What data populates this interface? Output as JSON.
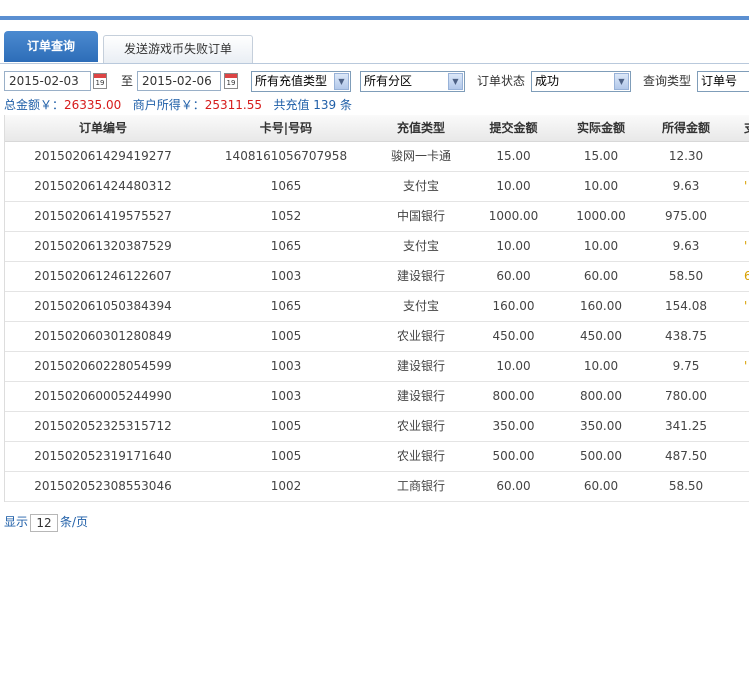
{
  "tabs": [
    {
      "label": "订单查询"
    },
    {
      "label": "发送游戏币失败订单"
    }
  ],
  "filters": {
    "start_date": "2015-02-03",
    "range_separator": "至",
    "end_date": "2015-02-06",
    "calendar_icon_text": "19",
    "recharge_type": "所有充值类型",
    "region": "所有分区",
    "order_status_label": "订单状态",
    "order_status": "成功",
    "query_type_label": "查询类型",
    "query_type": "订单号"
  },
  "summary": {
    "total_label": "总金额￥：",
    "total_value": "26335.00",
    "merchant_label": "商户所得￥：",
    "merchant_value": "25311.55",
    "count_text": "共充值 139 条"
  },
  "table": {
    "columns": [
      "订单编号",
      "卡号|号码",
      "充值类型",
      "提交金额",
      "实际金额",
      "所得金额",
      "支"
    ],
    "rows": [
      {
        "order_no": "201502061429419277",
        "card": "1408161056707958",
        "type": "骏网一卡通",
        "submit": "15.00",
        "actual": "15.00",
        "earned": "12.30",
        "extra": ""
      },
      {
        "order_no": "201502061424480312",
        "card": "1065",
        "type": "支付宝",
        "submit": "10.00",
        "actual": "10.00",
        "earned": "9.63",
        "extra": "'"
      },
      {
        "order_no": "201502061419575527",
        "card": "1052",
        "type": "中国银行",
        "submit": "1000.00",
        "actual": "1000.00",
        "earned": "975.00",
        "extra": ""
      },
      {
        "order_no": "201502061320387529",
        "card": "1065",
        "type": "支付宝",
        "submit": "10.00",
        "actual": "10.00",
        "earned": "9.63",
        "extra": "'"
      },
      {
        "order_no": "201502061246122607",
        "card": "1003",
        "type": "建设银行",
        "submit": "60.00",
        "actual": "60.00",
        "earned": "58.50",
        "extra": "6"
      },
      {
        "order_no": "201502061050384394",
        "card": "1065",
        "type": "支付宝",
        "submit": "160.00",
        "actual": "160.00",
        "earned": "154.08",
        "extra": "'"
      },
      {
        "order_no": "201502060301280849",
        "card": "1005",
        "type": "农业银行",
        "submit": "450.00",
        "actual": "450.00",
        "earned": "438.75",
        "extra": ""
      },
      {
        "order_no": "201502060228054599",
        "card": "1003",
        "type": "建设银行",
        "submit": "10.00",
        "actual": "10.00",
        "earned": "9.75",
        "extra": "'"
      },
      {
        "order_no": "201502060005244990",
        "card": "1003",
        "type": "建设银行",
        "submit": "800.00",
        "actual": "800.00",
        "earned": "780.00",
        "extra": ""
      },
      {
        "order_no": "201502052325315712",
        "card": "1005",
        "type": "农业银行",
        "submit": "350.00",
        "actual": "350.00",
        "earned": "341.25",
        "extra": ""
      },
      {
        "order_no": "201502052319171640",
        "card": "1005",
        "type": "农业银行",
        "submit": "500.00",
        "actual": "500.00",
        "earned": "487.50",
        "extra": ""
      },
      {
        "order_no": "201502052308553046",
        "card": "1002",
        "type": "工商银行",
        "submit": "60.00",
        "actual": "60.00",
        "earned": "58.50",
        "extra": ""
      }
    ]
  },
  "pager": {
    "show_label": "显示",
    "page_size": "12",
    "per_page_label": "条/页"
  },
  "colors": {
    "accent": "#2d6db8",
    "top_bar": "#5b8fd1",
    "summary_key": "#1f5fa8",
    "summary_value": "#d61b1b",
    "extra_mark": "#d8a000"
  },
  "icons": {
    "calendar": "calendar-icon",
    "dropdown": "chevron-down-icon"
  }
}
